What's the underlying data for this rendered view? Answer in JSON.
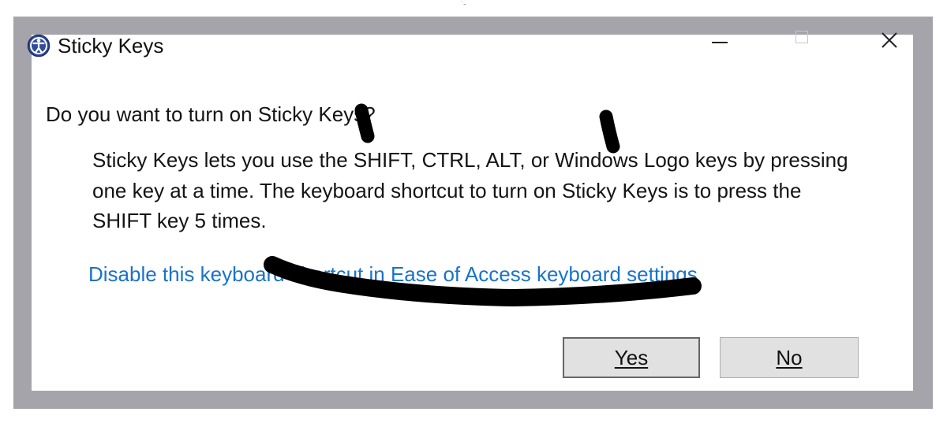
{
  "window": {
    "title": "Sticky Keys",
    "icon": "ease-of-access-icon",
    "controls": {
      "minimize_icon": "minimize-icon",
      "maximize_icon": "maximize-icon",
      "close_icon": "close-icon"
    }
  },
  "content": {
    "question": "Do you want to turn on Sticky Keys?",
    "description_lines": [
      "Sticky Keys lets you use the SHIFT, CTRL, ALT, or Windows Logo keys by pressing",
      "one key at a time. The keyboard shortcut to turn on Sticky Keys is to press the",
      "SHIFT key 5 times."
    ],
    "link": "Disable this keyboard shortcut in Ease of Access keyboard settings"
  },
  "buttons": {
    "yes_label": "Yes",
    "no_label": "No"
  },
  "colors": {
    "link": "#1a73c8",
    "frame": "#a6a4ab",
    "button_face": "#e1e1e1",
    "scribble": "#000000"
  }
}
